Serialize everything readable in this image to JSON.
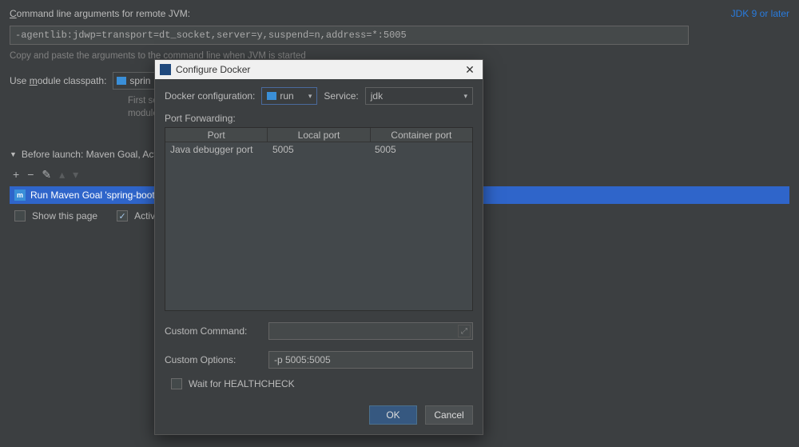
{
  "background": {
    "cmdline_label_pre": "C",
    "cmdline_label_post": "ommand line arguments for remote JVM:",
    "cmdline_value": "-agentlib:jdwp=transport=dt_socket,server=y,suspend=n,address=*:5005",
    "jdk_link": "JDK 9 or later",
    "hint": "Copy and paste the arguments to the command line when JVM is started",
    "module_label_pre": "Use ",
    "module_label_u": "m",
    "module_label_post": "odule classpath:",
    "module_value": "sprin",
    "module_note_line1": "First sear",
    "module_note_line2": "module c"
  },
  "before_launch": {
    "header": "Before launch: Maven Goal, Activat",
    "maven_text": "Run Maven Goal 'spring-boot-v",
    "show_this_page": "Show this page",
    "activate": "Activate to"
  },
  "dialog": {
    "title": "Configure Docker",
    "docker_cfg_label": "Docker configuration:",
    "docker_cfg_value": "run",
    "service_label": "Service:",
    "service_value": "jdk",
    "port_forwarding_label": "Port Forwarding:",
    "pf_headers": {
      "port": "Port",
      "local": "Local port",
      "container": "Container port"
    },
    "pf_row": {
      "port": "Java debugger port",
      "local": "5005",
      "container": "5005"
    },
    "custom_command_label": "Custom Command:",
    "custom_command_value": "",
    "custom_options_label": "Custom Options:",
    "custom_options_value": "-p 5005:5005",
    "healthcheck_label": "Wait for HEALTHCHECK",
    "ok": "OK",
    "cancel": "Cancel"
  }
}
